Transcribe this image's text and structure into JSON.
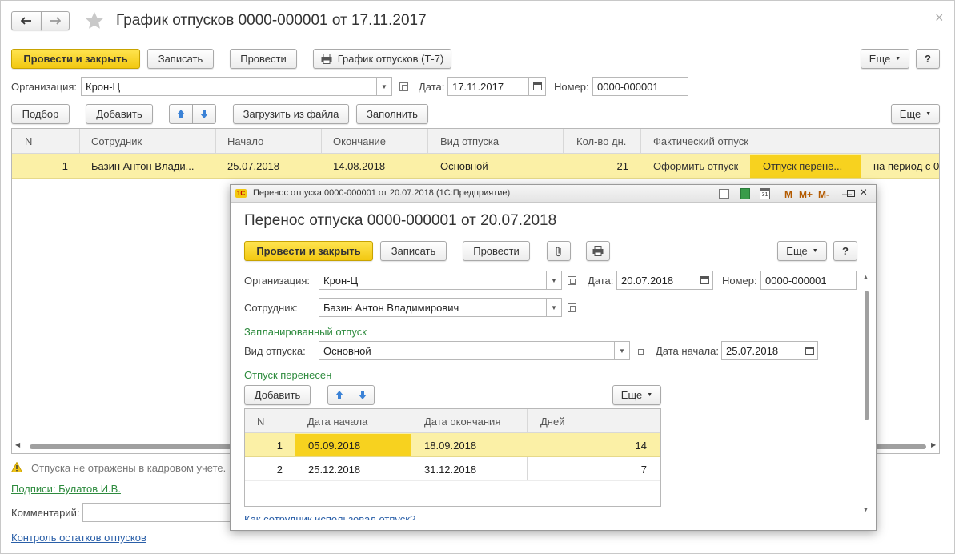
{
  "main": {
    "title": "График отпусков 0000-000001 от 17.11.2017",
    "toolbar": {
      "post_close": "Провести и закрыть",
      "save": "Записать",
      "post": "Провести",
      "print": "График отпусков (Т-7)",
      "more": "Еще",
      "help": "?"
    },
    "header": {
      "org_label": "Организация:",
      "org_value": "Крон-Ц",
      "date_label": "Дата:",
      "date_value": "17.11.2017",
      "number_label": "Номер:",
      "number_value": "0000-000001"
    },
    "table_toolbar": {
      "pick": "Подбор",
      "add": "Добавить",
      "load": "Загрузить из файла",
      "fill": "Заполнить",
      "more": "Еще"
    },
    "table": {
      "columns": [
        "N",
        "Сотрудник",
        "Начало",
        "Окончание",
        "Вид отпуска",
        "Кол-во дн.",
        "Фактический отпуск"
      ],
      "row": {
        "n": "1",
        "employee": "Базин Антон Влади...",
        "start": "25.07.2018",
        "end": "14.08.2018",
        "kind": "Основной",
        "days": "21",
        "make_link": "Оформить отпуск",
        "transfer_link": "Отпуск перене...",
        "period": "на период с 0"
      }
    },
    "footer": {
      "warning": "Отпуска не отражены в кадровом учете.",
      "signatures": "Подписи: Булатов И.В.",
      "comment_label": "Комментарий:",
      "control_link": "Контроль остатков отпусков"
    }
  },
  "dialog": {
    "window_title": "Перенос отпуска 0000-000001 от 20.07.2018  (1С:Предприятие)",
    "title": "Перенос отпуска 0000-000001 от 20.07.2018",
    "toolbar": {
      "post_close": "Провести и закрыть",
      "save": "Записать",
      "post": "Провести",
      "more": "Еще",
      "help": "?"
    },
    "header_buttons": [
      "M",
      "M+",
      "M-"
    ],
    "org_label": "Организация:",
    "org_value": "Крон-Ц",
    "date_label": "Дата:",
    "date_value": "20.07.2018",
    "number_label": "Номер:",
    "number_value": "0000-000001",
    "employee_label": "Сотрудник:",
    "employee_value": "Базин Антон Владимирович",
    "planned_group": "Запланированный отпуск",
    "kind_label": "Вид отпуска:",
    "kind_value": "Основной",
    "start_label": "Дата начала:",
    "start_value": "25.07.2018",
    "transferred_group": "Отпуск перенесен",
    "add": "Добавить",
    "more2": "Еще",
    "table": {
      "columns": [
        "N",
        "Дата начала",
        "Дата окончания",
        "Дней"
      ],
      "rows": [
        {
          "n": "1",
          "start": "05.09.2018",
          "end": "18.09.2018",
          "days": "14"
        },
        {
          "n": "2",
          "start": "25.12.2018",
          "end": "31.12.2018",
          "days": "7"
        }
      ]
    },
    "bottom_link": "Как сотрудник использовал отпуск?"
  },
  "colors": {
    "accent_yellow": "#f7d21f",
    "row_highlight": "#fbf0a6",
    "green_text": "#2e8b3e",
    "link_blue": "#2a5fa8"
  }
}
